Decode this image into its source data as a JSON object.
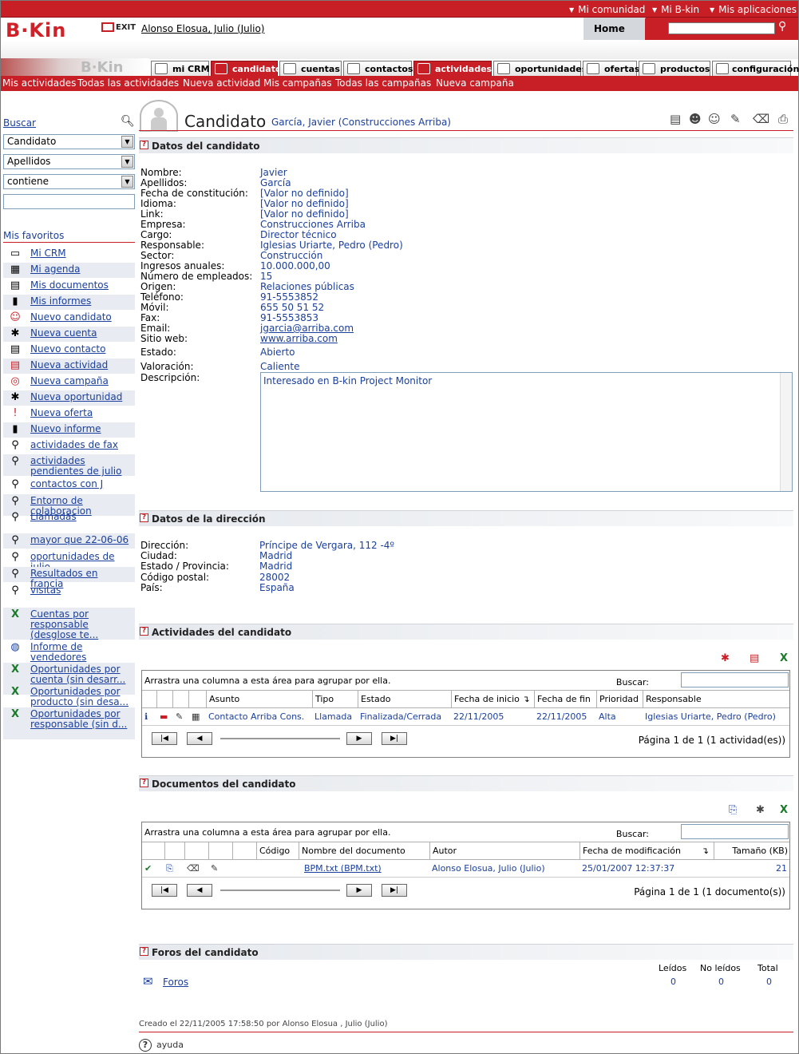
{
  "topbar": {
    "links": [
      "Mi comunidad",
      "Mi B-kin",
      "Mis aplicaciones"
    ]
  },
  "header": {
    "logo": "B·Kin",
    "exit": "EXIT",
    "user": "Alonso Elosua, Julio (Julio)",
    "home": "Home",
    "search_value": ""
  },
  "tabs": [
    {
      "label": "mi CRM",
      "active": false
    },
    {
      "label": "candidatos",
      "active": true
    },
    {
      "label": "cuentas",
      "active": false
    },
    {
      "label": "contactos",
      "active": false
    },
    {
      "label": "actividades",
      "active": false
    },
    {
      "label": "oportunidades",
      "active": false
    },
    {
      "label": "ofertas",
      "active": false
    },
    {
      "label": "productos",
      "active": false
    },
    {
      "label": "configuración",
      "active": false
    }
  ],
  "subnav": [
    "Mis actividades",
    "Todas las actividades",
    "Nueva actividad",
    "Mis campañas",
    "Todas las campañas",
    "Nueva campaña"
  ],
  "left": {
    "buscar": "Buscar",
    "selects": [
      "Candidato",
      "Apellidos",
      "contiene"
    ],
    "search_value": "",
    "favorites_title": "Mis favoritos",
    "favorites": [
      {
        "icon": "monitor-icon",
        "label": "Mi CRM"
      },
      {
        "icon": "calendar-icon",
        "label": "Mi agenda"
      },
      {
        "icon": "document-icon",
        "label": "Mis documentos"
      },
      {
        "icon": "chart-icon",
        "label": "Mis informes"
      },
      {
        "icon": "new-candidate-icon",
        "label": "Nuevo candidato"
      },
      {
        "icon": "new-account-icon",
        "label": "Nueva cuenta"
      },
      {
        "icon": "new-contact-icon",
        "label": "Nuevo contacto"
      },
      {
        "icon": "new-activity-icon",
        "label": "Nueva actividad"
      },
      {
        "icon": "new-campaign-icon",
        "label": "Nueva campaña"
      },
      {
        "icon": "new-opportunity-icon",
        "label": "Nueva oportunidad"
      },
      {
        "icon": "new-offer-icon",
        "label": "Nueva oferta"
      },
      {
        "icon": "new-report-icon",
        "label": "Nuevo informe"
      },
      {
        "icon": "magnifier-icon",
        "label": "actividades de fax"
      },
      {
        "icon": "magnifier-icon",
        "label": "actividades pendientes de julio"
      },
      {
        "icon": "magnifier-icon",
        "label": "contactos con J"
      },
      {
        "icon": "magnifier-icon",
        "label": "Entorno de colaboracion"
      },
      {
        "icon": "magnifier-icon",
        "label": "Llamadas"
      },
      {
        "icon": "magnifier-icon",
        "label": "mayor que 22-06-06"
      },
      {
        "icon": "magnifier-icon",
        "label": "oportunidades de julio"
      },
      {
        "icon": "magnifier-icon",
        "label": "Resultados en francia"
      },
      {
        "icon": "magnifier-icon",
        "label": "visitas"
      },
      {
        "icon": "excel-icon",
        "label": "Cuentas por responsable (desglose te..."
      },
      {
        "icon": "globe-icon",
        "label": "Informe de vendedores"
      },
      {
        "icon": "excel-icon",
        "label": "Oportunidades por cuenta (sin desarr..."
      },
      {
        "icon": "excel-icon",
        "label": "Oportunidades por producto (sin desa..."
      },
      {
        "icon": "excel-icon",
        "label": "Oportunidades por responsable (sin d..."
      }
    ]
  },
  "page": {
    "title": "Candidato",
    "subtitle": "García, Javier (Construcciones Arriba)"
  },
  "sections": {
    "datos": "Datos del candidato",
    "direccion": "Datos de la dirección",
    "actividades": "Actividades del candidato",
    "documentos": "Documentos del candidato",
    "foros": "Foros del candidato"
  },
  "fields": [
    {
      "label": "Nombre:",
      "value": "Javier",
      "link": false
    },
    {
      "label": "Apellidos:",
      "value": "García",
      "link": false
    },
    {
      "label": "Fecha de constitución:",
      "value": "[Valor no definido]",
      "link": false
    },
    {
      "label": "Idioma:",
      "value": "[Valor no definido]",
      "link": false
    },
    {
      "label": "Link:",
      "value": "[Valor no definido]",
      "link": false
    },
    {
      "label": "Empresa:",
      "value": "Construcciones Arriba",
      "link": false
    },
    {
      "label": "Cargo:",
      "value": "Director técnico",
      "link": false
    },
    {
      "label": "Responsable:",
      "value": "Iglesias Uriarte, Pedro (Pedro)",
      "link": false
    },
    {
      "label": "Sector:",
      "value": "Construcción",
      "link": false
    },
    {
      "label": "Ingresos anuales:",
      "value": "10.000.000,00",
      "link": false
    },
    {
      "label": "Número de empleados:",
      "value": "15",
      "link": false
    },
    {
      "label": "Origen:",
      "value": "Relaciones públicas",
      "link": false
    },
    {
      "label": "Teléfono:",
      "value": "91-5553852",
      "link": false
    },
    {
      "label": "Móvil:",
      "value": "655 50 51 52",
      "link": false
    },
    {
      "label": "Fax:",
      "value": "91-5553853",
      "link": false
    },
    {
      "label": "Email:",
      "value": "jgarcia@arriba.com",
      "link": true
    },
    {
      "label": "Sitio web:",
      "value": "www.arriba.com",
      "link": true
    },
    {
      "label": "Estado:",
      "value": "Abierto",
      "link": false
    },
    {
      "label": "Valoración:",
      "value": "Caliente",
      "link": false
    },
    {
      "label": "Descripción:",
      "value": "",
      "link": false
    }
  ],
  "description": "Interesado en B-kin Project Monitor",
  "address": [
    {
      "label": "Dirección:",
      "value": "Príncipe de Vergara, 112 -4º"
    },
    {
      "label": "Ciudad:",
      "value": "Madrid"
    },
    {
      "label": "Estado / Provincia:",
      "value": "Madrid"
    },
    {
      "label": "Código postal:",
      "value": "28002"
    },
    {
      "label": "País:",
      "value": "España"
    }
  ],
  "activities": {
    "group_text": "Arrastra una columna a esta área para agrupar por ella.",
    "search_label": "Buscar:",
    "columns": [
      "Asunto",
      "Tipo",
      "Estado",
      "Fecha de inicio",
      "Fecha de fin",
      "Prioridad",
      "Responsable"
    ],
    "rows": [
      [
        "Contacto Arriba Cons.",
        "Llamada",
        "Finalizada/Cerrada",
        "22/11/2005",
        "22/11/2005",
        "Alta",
        "Iglesias Uriarte, Pedro (Pedro)"
      ]
    ],
    "pager": "Página 1 de 1 (1 actividad(es))"
  },
  "documents": {
    "group_text": "Arrastra una columna a esta área para agrupar por ella.",
    "search_label": "Buscar:",
    "columns": [
      "Código",
      "Nombre del documento",
      "Autor",
      "Fecha de modificación",
      "Tamaño (KB)"
    ],
    "rows": [
      [
        "",
        "BPM.txt (BPM.txt)",
        "Alonso Elosua, Julio (Julio)",
        "25/01/2007 12:37:37",
        "21"
      ]
    ],
    "pager": "Página 1 de 1 (1 documento(s))"
  },
  "forums": {
    "label": "Foros",
    "columns": [
      "Leídos",
      "No leídos",
      "Total"
    ],
    "values": [
      "0",
      "0",
      "0"
    ]
  },
  "footer": {
    "created": "Creado el 22/11/2005 17:58:50 por Alonso Elosua , Julio (Julio)",
    "help": "ayuda"
  },
  "colors": {
    "brand": "#c81e26",
    "link": "#1a3f9c"
  }
}
